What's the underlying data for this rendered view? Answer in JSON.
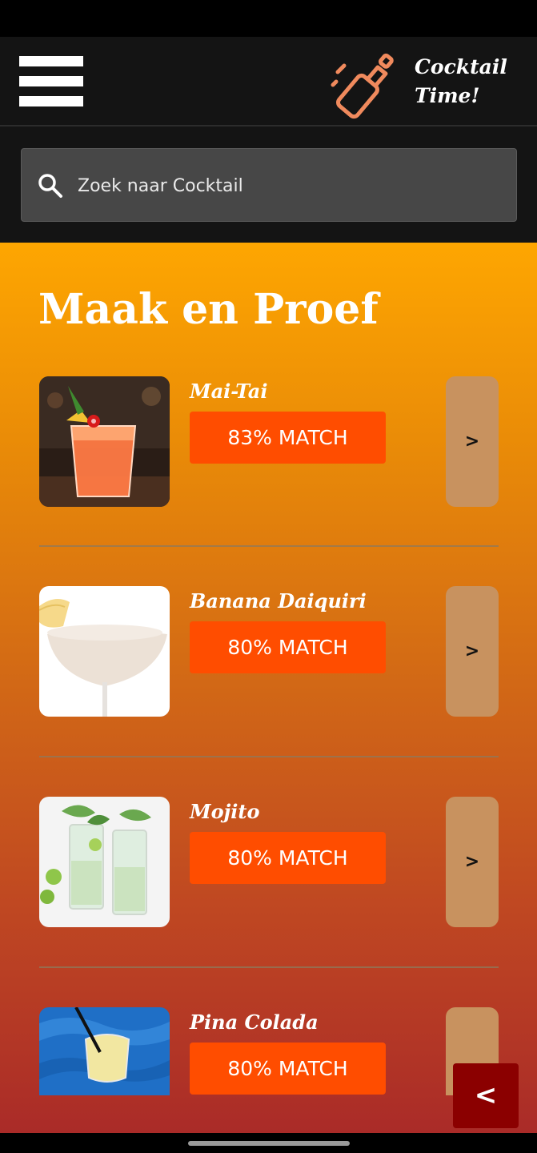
{
  "header": {
    "menu_icon": "hamburger-menu-icon",
    "logo_icon": "cocktail-shaker-icon",
    "brand_line1": "Cocktail",
    "brand_line2": "Time!"
  },
  "search": {
    "icon": "search-icon",
    "placeholder": "Zoek naar Cocktail",
    "value": ""
  },
  "main": {
    "title": "Maak en Proef",
    "cocktails": [
      {
        "name": "Mai-Tai",
        "match": "83% MATCH",
        "button": ">"
      },
      {
        "name": "Banana Daiquiri",
        "match": "80% MATCH",
        "button": ">"
      },
      {
        "name": "Mojito",
        "match": "80% MATCH",
        "button": ">"
      },
      {
        "name": "Pina Colada",
        "match": "80% MATCH",
        "button": ">"
      }
    ]
  },
  "back_button": {
    "label": "<"
  },
  "colors": {
    "accent_badge": "#ff4d00",
    "go_button": "#c8925f",
    "back_button": "#8b0000",
    "gradient_top": "#fea601",
    "gradient_bottom": "#aa2b28"
  }
}
